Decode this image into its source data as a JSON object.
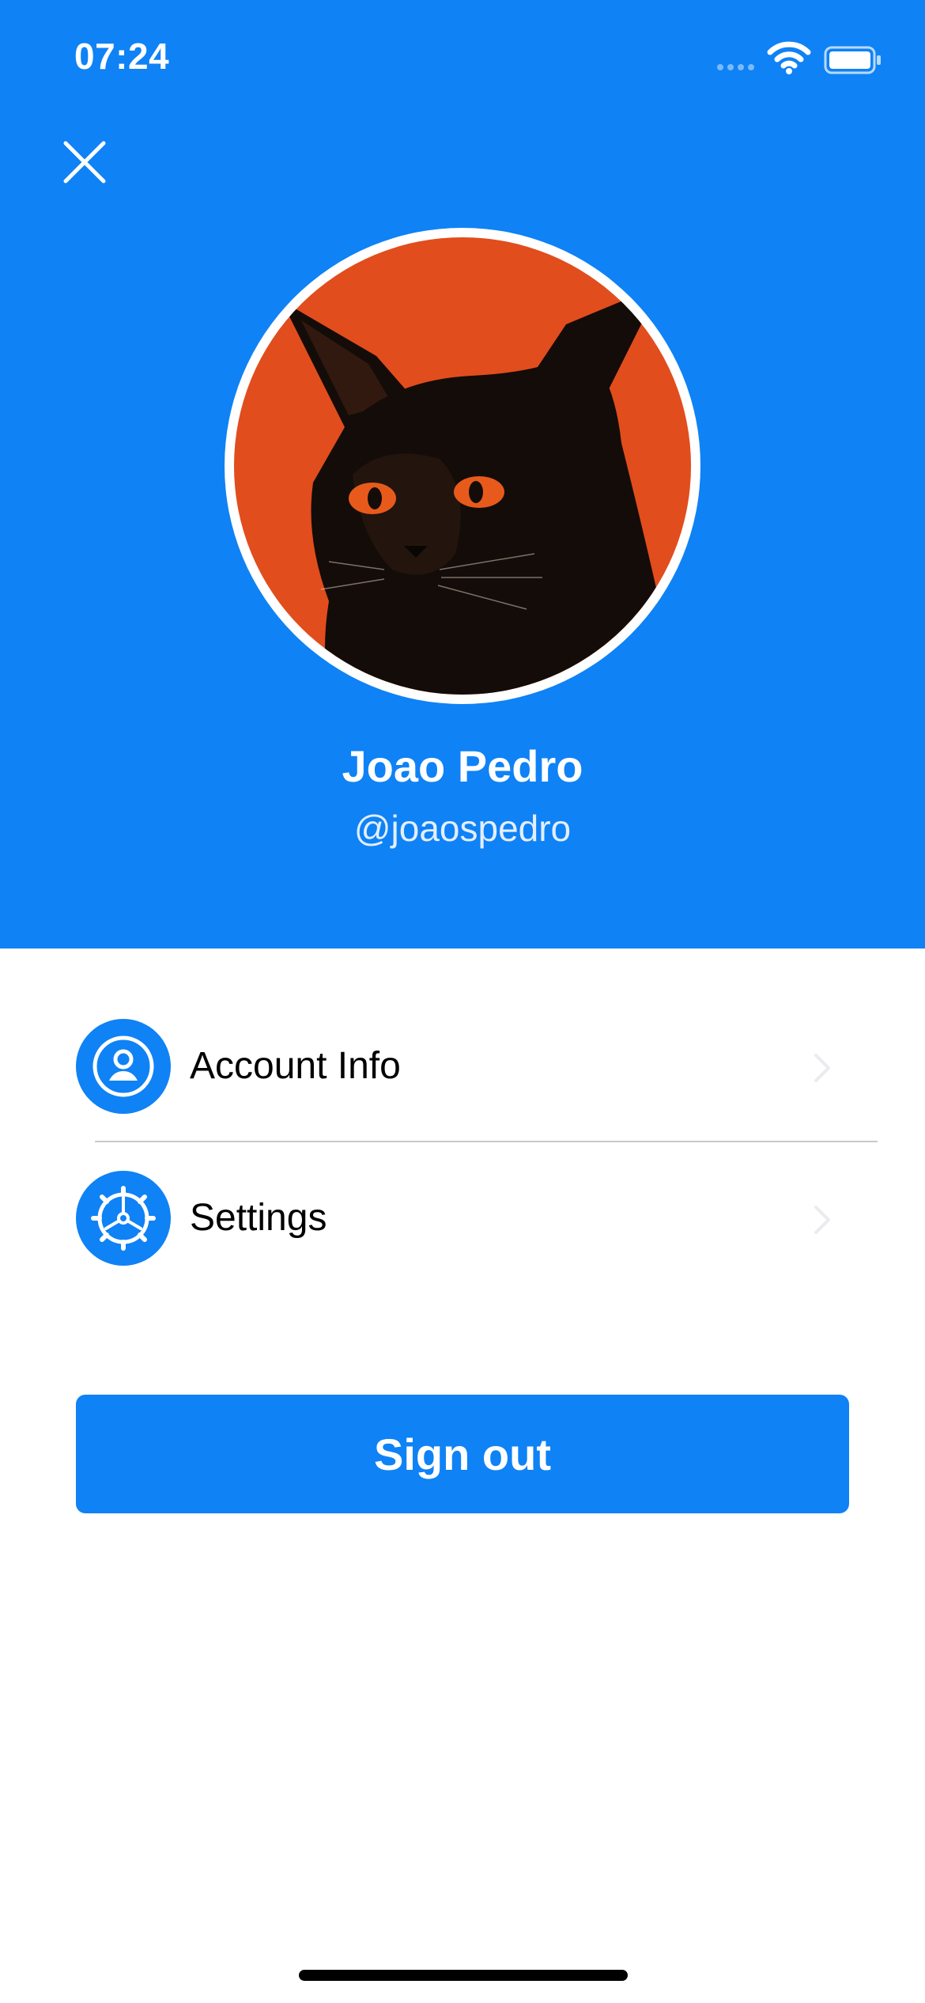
{
  "status_bar": {
    "time": "07:24"
  },
  "profile": {
    "name": "Joao Pedro",
    "handle": "@joaospedro"
  },
  "menu": {
    "items": [
      {
        "label": "Account Info",
        "icon": "person-circle-icon"
      },
      {
        "label": "Settings",
        "icon": "gear-icon"
      }
    ]
  },
  "actions": {
    "sign_out_label": "Sign out"
  },
  "colors": {
    "accent": "#0F82F5",
    "avatar_background": "#E4501E",
    "handle_text": "#E3EEFF",
    "divider": "#C8C8CC"
  }
}
